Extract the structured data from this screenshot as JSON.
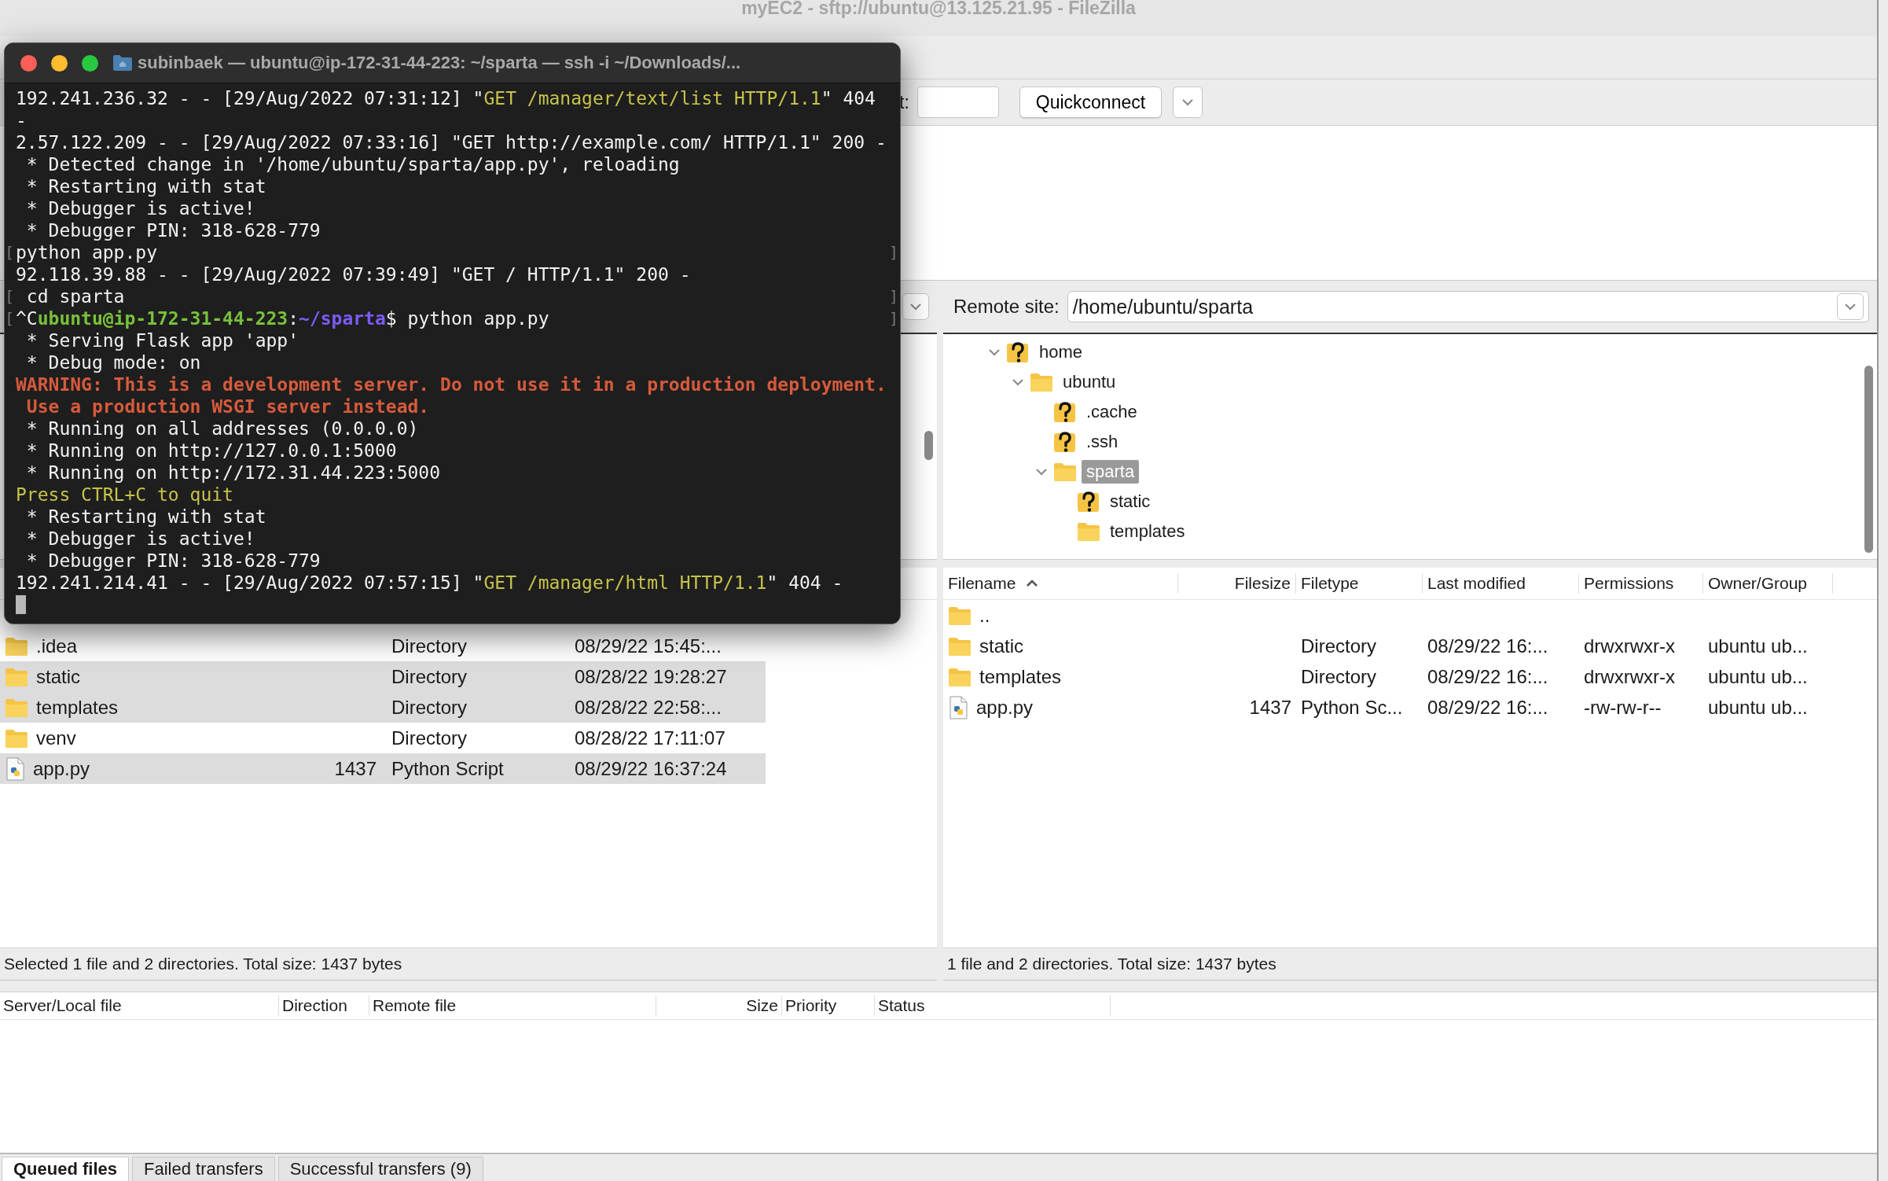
{
  "window": {
    "title": "myEC2 - sftp://ubuntu@13.125.21.95 - FileZilla"
  },
  "quickconnect": {
    "port_label": "t:",
    "button": "Quickconnect"
  },
  "local": {
    "files": [
      {
        "kind": "folder",
        "name": ".idea",
        "type": "Directory",
        "modified": "08/29/22 15:45:...",
        "selected": false
      },
      {
        "kind": "folder",
        "name": "static",
        "type": "Directory",
        "modified": "08/28/22 19:28:27",
        "selected": true
      },
      {
        "kind": "folder",
        "name": "templates",
        "type": "Directory",
        "modified": "08/28/22 22:58:...",
        "selected": true
      },
      {
        "kind": "folder",
        "name": "venv",
        "type": "Directory",
        "modified": "08/28/22 17:11:07",
        "selected": false
      },
      {
        "kind": "file",
        "name": "app.py",
        "size": "1437",
        "type": "Python Script",
        "modified": "08/29/22 16:37:24",
        "selected": true
      }
    ],
    "status": "Selected 1 file and 2 directories. Total size: 1437 bytes"
  },
  "remote": {
    "label": "Remote site:",
    "path": "/home/ubuntu/sparta",
    "tree": [
      {
        "name": "home",
        "kind": "unknown",
        "expanded": true,
        "selected": false,
        "children": [
          {
            "name": "ubuntu",
            "kind": "folder",
            "expanded": true,
            "selected": false,
            "children": [
              {
                "name": ".cache",
                "kind": "unknown",
                "selected": false
              },
              {
                "name": ".ssh",
                "kind": "unknown",
                "selected": false
              },
              {
                "name": "sparta",
                "kind": "folder",
                "expanded": true,
                "selected": true,
                "children": [
                  {
                    "name": "static",
                    "kind": "unknown",
                    "selected": false
                  },
                  {
                    "name": "templates",
                    "kind": "folder",
                    "selected": false
                  }
                ]
              }
            ]
          }
        ]
      }
    ],
    "columns": [
      {
        "label": "Filename",
        "sorted": true
      },
      {
        "label": "Filesize"
      },
      {
        "label": "Filetype"
      },
      {
        "label": "Last modified"
      },
      {
        "label": "Permissions"
      },
      {
        "label": "Owner/Group"
      }
    ],
    "files": [
      {
        "kind": "folder",
        "name": "..",
        "selected": false
      },
      {
        "kind": "folder",
        "name": "static",
        "type": "Directory",
        "modified": "08/29/22 16:...",
        "permissions": "drwxrwxr-x",
        "owner": "ubuntu ub...",
        "selected": false
      },
      {
        "kind": "folder",
        "name": "templates",
        "type": "Directory",
        "modified": "08/29/22 16:...",
        "permissions": "drwxrwxr-x",
        "owner": "ubuntu ub...",
        "selected": false
      },
      {
        "kind": "file",
        "name": "app.py",
        "size": "1437",
        "type": "Python Sc...",
        "modified": "08/29/22 16:...",
        "permissions": "-rw-rw-r--",
        "owner": "ubuntu ub...",
        "selected": false
      }
    ],
    "status": "1 file and 2 directories. Total size: 1437 bytes"
  },
  "queue": {
    "columns": [
      "Server/Local file",
      "Direction",
      "Remote file",
      "Size",
      "Priority",
      "Status"
    ],
    "tabs": [
      {
        "label": "Queued files",
        "selected": true
      },
      {
        "label": "Failed transfers",
        "selected": false
      },
      {
        "label": "Successful transfers (9)",
        "selected": false
      }
    ]
  },
  "terminal": {
    "title": "subinbaek — ubuntu@ip-172-31-44-223: ~/sparta — ssh -i ~/Downloads/...",
    "lines": [
      {
        "kind": "text",
        "segments": [
          {
            "kind": "plain",
            "text": "192.241.236.32 - - [29/Aug/2022 07:31:12] \""
          },
          {
            "kind": "string",
            "text": "GET /manager/text/list HTTP/1.1"
          },
          {
            "kind": "plain",
            "text": "\" 404"
          }
        ]
      },
      {
        "kind": "text",
        "segments": [
          {
            "kind": "plain",
            "text": "-"
          }
        ]
      },
      {
        "kind": "text",
        "segments": [
          {
            "kind": "plain",
            "text": "2.57.122.209 - - [29/Aug/2022 07:33:16] \"GET http://example.com/ HTTP/1.1\" 200 -"
          }
        ]
      },
      {
        "kind": "text",
        "segments": [
          {
            "kind": "plain",
            "text": " * Detected change in '/home/ubuntu/sparta/app.py', reloading"
          }
        ]
      },
      {
        "kind": "text",
        "segments": [
          {
            "kind": "plain",
            "text": " * Restarting with stat"
          }
        ]
      },
      {
        "kind": "text",
        "segments": [
          {
            "kind": "plain",
            "text": " * Debugger is active!"
          }
        ]
      },
      {
        "kind": "text",
        "segments": [
          {
            "kind": "plain",
            "text": " * Debugger PIN: 318-628-779"
          }
        ]
      },
      {
        "kind": "text",
        "mark_left": "[",
        "mark_right": "]",
        "segments": [
          {
            "kind": "plain",
            "text": "python app.py"
          }
        ]
      },
      {
        "kind": "text",
        "segments": [
          {
            "kind": "plain",
            "text": "92.118.39.88 - - [29/Aug/2022 07:39:49] \"GET / HTTP/1.1\" 200 -"
          }
        ]
      },
      {
        "kind": "text",
        "mark_left": "[",
        "mark_right": "]",
        "segments": [
          {
            "kind": "plain",
            "text": " cd sparta"
          }
        ]
      },
      {
        "kind": "text",
        "mark_left": "[",
        "mark_right": "]",
        "segments": [
          {
            "kind": "plain",
            "text": "^C"
          },
          {
            "kind": "user",
            "text": "ubuntu@ip-172-31-44-223"
          },
          {
            "kind": "plain",
            "text": ":"
          },
          {
            "kind": "path",
            "text": "~/sparta"
          },
          {
            "kind": "plain",
            "text": "$ python app.py"
          }
        ]
      },
      {
        "kind": "text",
        "segments": [
          {
            "kind": "plain",
            "text": " * Serving Flask app 'app'"
          }
        ]
      },
      {
        "kind": "text",
        "segments": [
          {
            "kind": "plain",
            "text": " * Debug mode: on"
          }
        ]
      },
      {
        "kind": "text",
        "segments": [
          {
            "kind": "warning",
            "text": "WARNING: This is a development server. Do not use it in a production deployment."
          }
        ]
      },
      {
        "kind": "text",
        "segments": [
          {
            "kind": "warning",
            "text": " Use a production WSGI server instead."
          }
        ]
      },
      {
        "kind": "text",
        "segments": [
          {
            "kind": "plain",
            "text": " * Running on all addresses (0.0.0.0)"
          }
        ]
      },
      {
        "kind": "text",
        "segments": [
          {
            "kind": "plain",
            "text": " * Running on http://127.0.0.1:5000"
          }
        ]
      },
      {
        "kind": "text",
        "segments": [
          {
            "kind": "plain",
            "text": " * Running on http://172.31.44.223:5000"
          }
        ]
      },
      {
        "kind": "text",
        "segments": [
          {
            "kind": "string",
            "text": "Press CTRL+C to quit"
          }
        ]
      },
      {
        "kind": "text",
        "segments": [
          {
            "kind": "plain",
            "text": " * Restarting with stat"
          }
        ]
      },
      {
        "kind": "text",
        "segments": [
          {
            "kind": "plain",
            "text": " * Debugger is active!"
          }
        ]
      },
      {
        "kind": "text",
        "segments": [
          {
            "kind": "plain",
            "text": " * Debugger PIN: 318-628-779"
          }
        ]
      },
      {
        "kind": "text",
        "segments": [
          {
            "kind": "plain",
            "text": "192.241.214.41 - - [29/Aug/2022 07:57:15] \""
          },
          {
            "kind": "string",
            "text": "GET /manager/html HTTP/1.1"
          },
          {
            "kind": "plain",
            "text": "\" 404 -"
          }
        ]
      },
      {
        "kind": "cursor"
      }
    ]
  }
}
